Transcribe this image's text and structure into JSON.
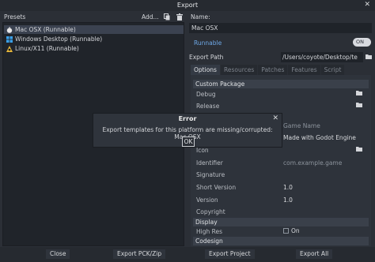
{
  "window": {
    "title": "Export"
  },
  "presets": {
    "label": "Presets",
    "add_label": "Add...",
    "items": [
      {
        "label": "Mac OSX (Runnable)",
        "icon": "apple-icon",
        "selected": true
      },
      {
        "label": "Windows Desktop (Runnable)",
        "icon": "windows-icon",
        "selected": false
      },
      {
        "label": "Linux/X11 (Runnable)",
        "icon": "linux-icon",
        "selected": false
      }
    ]
  },
  "preset": {
    "name_label": "Name:",
    "name_value": "Mac OSX",
    "runnable_label": "Runnable",
    "runnable_toggle": "ON",
    "export_path_label": "Export Path",
    "export_path_value": "/Users/coyote/Desktop/te"
  },
  "tabs": [
    "Options",
    "Resources",
    "Patches",
    "Features",
    "Script"
  ],
  "options": {
    "section_custom_package": "Custom Package",
    "debug_label": "Debug",
    "release_label": "Release",
    "name_col_label": "Game Name",
    "name_col_value": "Made with Godot Engine",
    "icon_label": "Icon",
    "identifier_label": "Identifier",
    "identifier_value": "com.example.game",
    "signature_label": "Signature",
    "short_version_label": "Short Version",
    "short_version_value": "1.0",
    "version_label": "Version",
    "version_value": "1.0",
    "copyright_label": "Copyright",
    "section_display": "Display",
    "high_res_label": "High Res",
    "high_res_value": "On",
    "section_codesign": "Codesign"
  },
  "dialog": {
    "title": "Error",
    "message": "Export templates for this platform are missing/corrupted: Mac OSX",
    "ok_label": "OK"
  },
  "bottom": {
    "close": "Close",
    "export_pck": "Export PCK/Zip",
    "export_project": "Export Project",
    "export_all": "Export All"
  },
  "colors": {
    "accent": "#6ea8e6",
    "background": "#2b2f36",
    "panel": "#20242a"
  }
}
